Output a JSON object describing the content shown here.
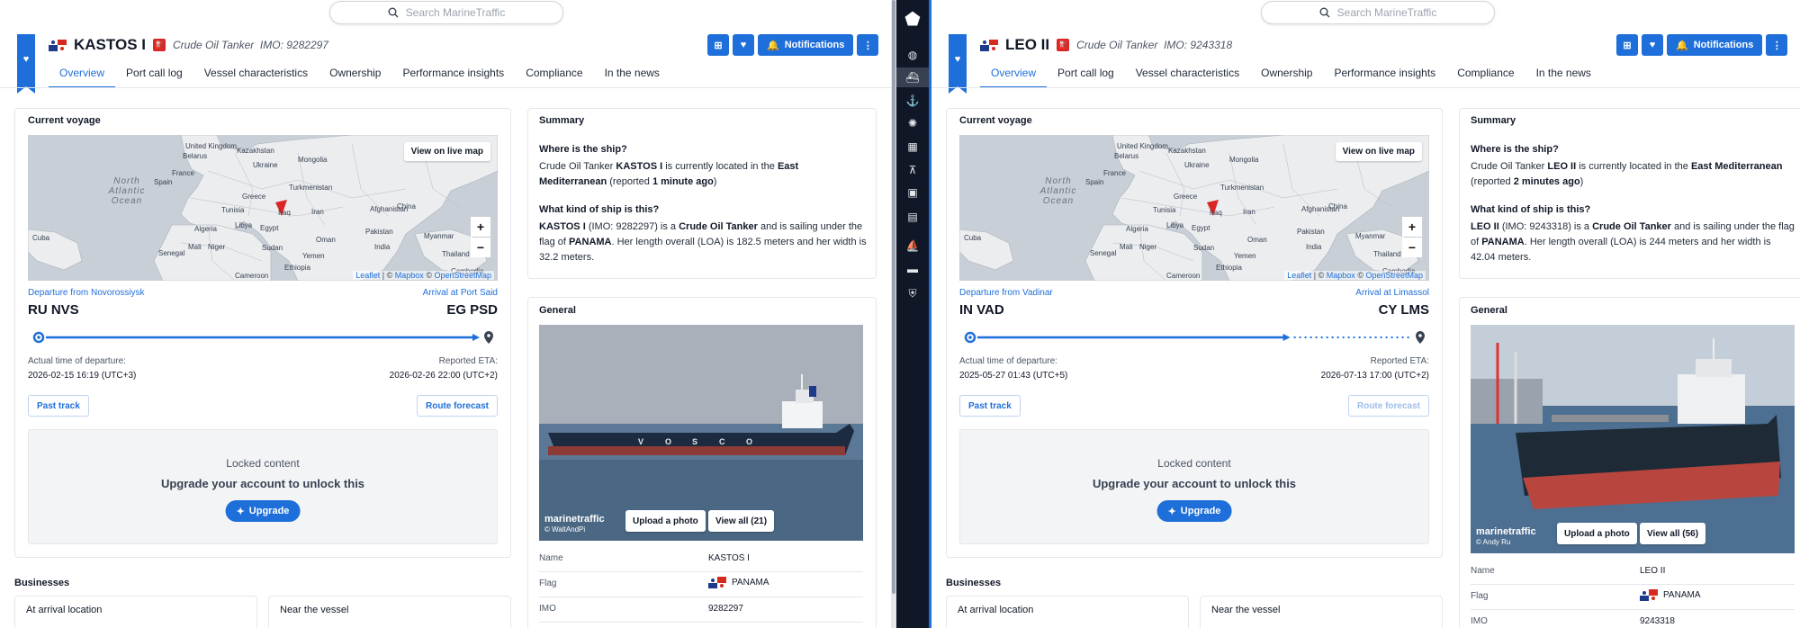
{
  "search": {
    "placeholder": "Search MarineTraffic"
  },
  "tabs": [
    "Overview",
    "Port call log",
    "Vessel characteristics",
    "Ownership",
    "Performance insights",
    "Compliance",
    "In the news"
  ],
  "actions": {
    "notifications": "Notifications"
  },
  "labels": {
    "current_voyage": "Current voyage",
    "view_live_map": "View on live map",
    "zoom_in": "+",
    "zoom_out": "−",
    "actual_departure": "Actual time of departure:",
    "reported_eta": "Reported ETA:",
    "past_track": "Past track",
    "route_forecast": "Route forecast",
    "locked_content": "Locked content",
    "upgrade_msg": "Upgrade your account to unlock this",
    "upgrade": "Upgrade",
    "summary": "Summary",
    "where_q": "Where is the ship?",
    "what_q": "What kind of ship is this?",
    "general": "General",
    "upload_photo": "Upload a photo",
    "businesses": "Businesses",
    "at_arrival": "At arrival location",
    "near_vessel": "Near the vessel",
    "row_name": "Name",
    "row_flag": "Flag",
    "row_imo": "IMO",
    "watermark": "marinetraffic"
  },
  "attribution": {
    "leaflet": "Leaflet",
    "sep1": " | © ",
    "mapbox": "Mapbox",
    "sep2": " © ",
    "osm": "OpenStreetMap"
  },
  "map_labels": {
    "ocean": "North Atlantic Ocean",
    "places": [
      "United Kingdom",
      "Belarus",
      "Kazakhstan",
      "Mongolia",
      "Ukraine",
      "France",
      "Spain",
      "Turkmenistan",
      "Greece",
      "Tunisia",
      "Iraq",
      "Iran",
      "Afghanistan",
      "China",
      "Libya",
      "Egypt",
      "Pakistan",
      "Algeria",
      "Oman",
      "India",
      "Myanmar",
      "Mali",
      "Niger",
      "Sudan",
      "Yemen",
      "Cuba",
      "Senegal",
      "Ethiopia",
      "Cameroon",
      "Thailand",
      "Cambodia"
    ]
  },
  "vessels": [
    {
      "name": "KASTOS I",
      "type": "Crude Oil Tanker",
      "imo_label": "IMO: 9282297",
      "departure_link": "Departure from Novorossiysk",
      "arrival_link": "Arrival at Port Said",
      "from_code": "RU NVS",
      "to_code": "EG PSD",
      "progress": 1.0,
      "departure_time": "2026-02-15 16:19 (UTC+3)",
      "eta": "2026-02-26 22:00 (UTC+2)",
      "route_forecast_enabled": true,
      "summary_where_pre": "Crude Oil Tanker ",
      "summary_where_name": "KASTOS I",
      "summary_where_mid": " is currently located in the ",
      "summary_where_region": "East Mediterranean",
      "summary_where_post1": " (reported ",
      "summary_where_time": "1 minute ago",
      "summary_where_post2": ")",
      "summary_what_name": "KASTOS I",
      "summary_what_imo": " (IMO: 9282297) is a ",
      "summary_what_type": "Crude Oil Tanker",
      "summary_what_mid": " and is sailing under the flag of ",
      "summary_what_flag": "PANAMA",
      "summary_what_post": ". Her length overall (LOA) is 182.5 meters and her width is 32.2 meters.",
      "view_all": "View all (21)",
      "photo_credit": "© WaltAndPi",
      "flag": "PANAMA",
      "imo": "9282297"
    },
    {
      "name": "LEO II",
      "type": "Crude Oil Tanker",
      "imo_label": "IMO: 9243318",
      "departure_link": "Departure from Vadinar",
      "arrival_link": "Arrival at Limassol",
      "from_code": "IN VAD",
      "to_code": "CY LMS",
      "progress": 0.72,
      "departure_time": "2025-05-27 01:43 (UTC+5)",
      "eta": "2026-07-13 17:00 (UTC+2)",
      "route_forecast_enabled": false,
      "summary_where_pre": "Crude Oil Tanker ",
      "summary_where_name": "LEO II",
      "summary_where_mid": " is currently located in the ",
      "summary_where_region": "East Mediterranean",
      "summary_where_post1": " (reported ",
      "summary_where_time": "2 minutes ago",
      "summary_where_post2": ")",
      "summary_what_name": "LEO II",
      "summary_what_imo": " (IMO: 9243318) is a ",
      "summary_what_type": "Crude Oil Tanker",
      "summary_what_mid": " and is sailing under the flag of ",
      "summary_what_flag": "PANAMA",
      "summary_what_post": ". Her length overall (LOA) is 244 meters and her width is 42.04 meters.",
      "view_all": "View all (56)",
      "photo_credit": "© Andy Ru",
      "flag": "PANAMA",
      "imo": "9243318"
    }
  ],
  "sidebar_icons": [
    "globe-icon",
    "ship-icon",
    "anchor-icon",
    "lighthouse-icon",
    "fleet-icon",
    "antenna-icon",
    "photos-icon",
    "news-icon",
    "ship-wave-icon",
    "card-icon",
    "shield-icon"
  ]
}
